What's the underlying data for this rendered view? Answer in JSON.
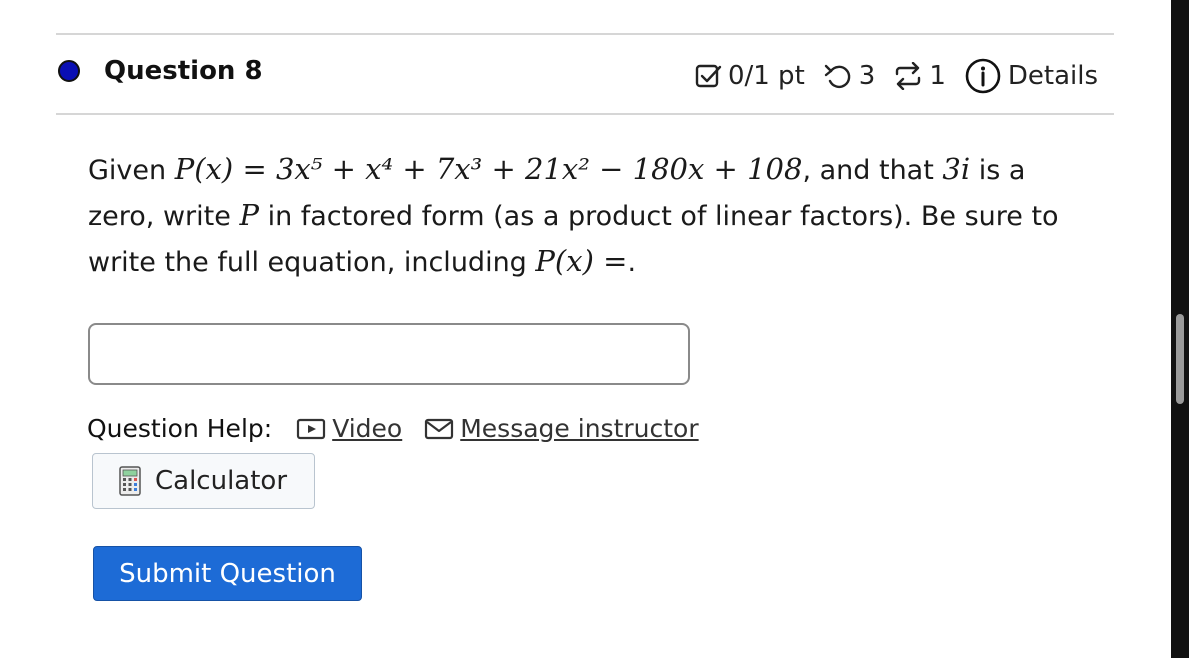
{
  "question": {
    "title": "Question 8",
    "points": "0/1 pt",
    "retries": "3",
    "versions": "1",
    "details_label": "Details"
  },
  "problem": {
    "given_label": "Given",
    "polynomial": "P(x) = 3x⁵ + x⁴ + 7x³ + 21x² − 180x + 108",
    "and_that": ", and that",
    "zero": "3i",
    "rest_1": "is a zero, write",
    "var_p": "P",
    "rest_2": "in factored form (as a product of linear factors). Be sure to write the full equation, including",
    "p_equals": "P(x) =",
    "end": "."
  },
  "answer": {
    "value": "",
    "placeholder": ""
  },
  "help": {
    "label": "Question Help:",
    "video": "Video",
    "message": "Message instructor"
  },
  "buttons": {
    "calculator": "Calculator",
    "submit": "Submit Question"
  },
  "colors": {
    "accent": "#1d6bd6",
    "status_dot": "#0a0fb4"
  },
  "icons": [
    "checkbox-icon",
    "retry-icon",
    "versions-icon",
    "info-icon",
    "video-icon",
    "mail-icon",
    "calculator-icon"
  ]
}
